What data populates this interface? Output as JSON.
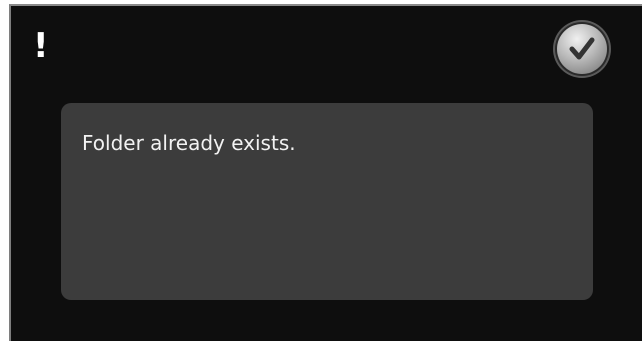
{
  "dialog": {
    "alert_icon_glyph": "!",
    "ok_button": {
      "icon": "check-icon"
    },
    "message": "Folder already exists."
  },
  "colors": {
    "background": "#0e0e0e",
    "panel": "#3c3c3c",
    "text": "#f2f2f2"
  }
}
